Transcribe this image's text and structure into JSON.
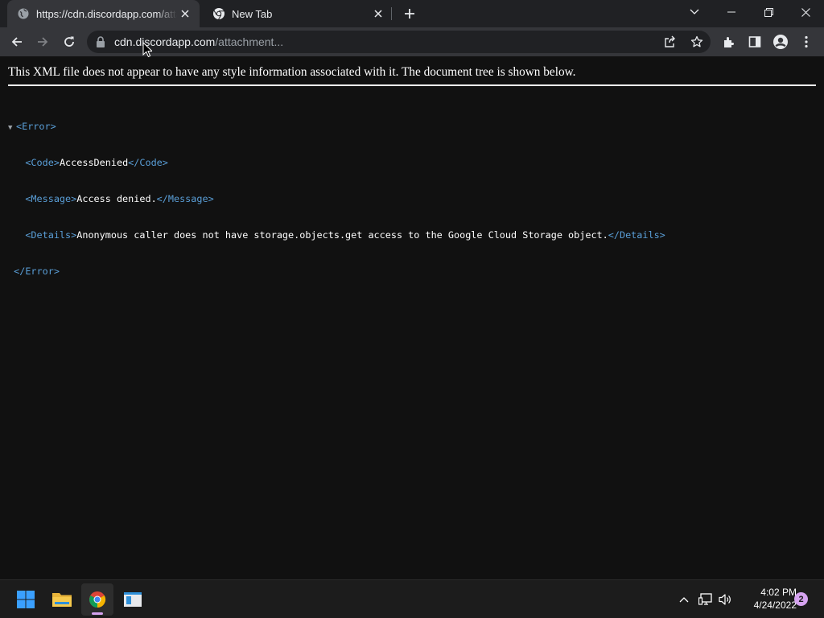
{
  "browser": {
    "tabs": [
      {
        "title": "https://cdn.discordapp.com/attachments/",
        "favicon": "globe-icon",
        "active": true
      },
      {
        "title": "New Tab",
        "favicon": "chrome-icon",
        "active": false
      }
    ],
    "address_bar": {
      "host": "cdn.discordapp.com",
      "path": "/attachment..."
    }
  },
  "page": {
    "notice": "This XML file does not appear to have any style information associated with it. The document tree is shown below.",
    "xml": {
      "root_open": "<Error>",
      "root_close": "</Error>",
      "code_open": "<Code>",
      "code_value": "AccessDenied",
      "code_close": "</Code>",
      "message_open": "<Message>",
      "message_value": "Access denied.",
      "message_close": "</Message>",
      "details_open": "<Details>",
      "details_value": "Anonymous caller does not have storage.objects.get access to the Google Cloud Storage object.",
      "details_close": "</Details>"
    }
  },
  "taskbar": {
    "time": "4:02 PM",
    "date": "4/24/2022",
    "notification_count": "2"
  },
  "colors": {
    "xml_tag": "#5a9fd8",
    "taskbar_accent": "#d6a3f0"
  }
}
